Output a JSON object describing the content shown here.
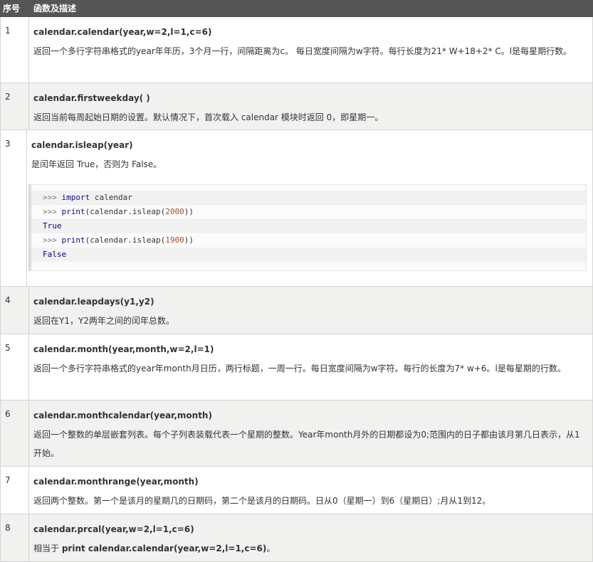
{
  "header": {
    "col_index": "序号",
    "col_func": "函数及描述"
  },
  "rows": [
    {
      "index": "1",
      "func": "calendar.calendar(year,w=2,l=1,c=6)",
      "desc": "返回一个多行字符串格式的year年年历，3个月一行，间隔距离为c。 每日宽度间隔为w字符。每行长度为21* W+18+2* C。l是每星期行数。"
    },
    {
      "index": "2",
      "func": "calendar.firstweekday( )",
      "desc": "返回当前每周起始日期的设置。默认情况下，首次载入 calendar 模块时返回 0，即星期一。"
    },
    {
      "index": "3",
      "func": "calendar.isleap(year)",
      "desc": "是闰年返回 True，否则为 False。",
      "code": {
        "line1_prompt": ">>>",
        "line1_kw": "import",
        "line1_rest": " calendar",
        "line2_prompt": ">>>",
        "line2_kw": "print",
        "line2_a": "(calendar.isleap(",
        "line2_num": "2000",
        "line2_b": "))",
        "line3": "True",
        "line4_prompt": ">>>",
        "line4_kw": "print",
        "line4_a": "(calendar.isleap(",
        "line4_num": "1900",
        "line4_b": "))",
        "line5": "False"
      }
    },
    {
      "index": "4",
      "func": "calendar.leapdays(y1,y2)",
      "desc": "返回在Y1，Y2两年之间的闰年总数。"
    },
    {
      "index": "5",
      "func": "calendar.month(year,month,w=2,l=1)",
      "desc": "返回一个多行字符串格式的year年month月日历，两行标题，一周一行。每日宽度间隔为w字符。每行的长度为7* w+6。l是每星期的行数。"
    },
    {
      "index": "6",
      "func": "calendar.monthcalendar(year,month)",
      "desc": "返回一个整数的单层嵌套列表。每个子列表装载代表一个星期的整数。Year年month月外的日期都设为0;范围内的日子都由该月第几日表示，从1开始。"
    },
    {
      "index": "7",
      "func": "calendar.monthrange(year,month)",
      "desc": "返回两个整数。第一个是该月的星期几的日期码，第二个是该月的日期码。日从0（星期一）到6（星期日）;月从1到12。"
    },
    {
      "index": "8",
      "func": "calendar.prcal(year,w=2,l=1,c=6)",
      "desc_prefix": "相当于 ",
      "desc_code": "print calendar.calendar(year,w=2,l=1,c=6)",
      "desc_suffix": "。"
    }
  ]
}
